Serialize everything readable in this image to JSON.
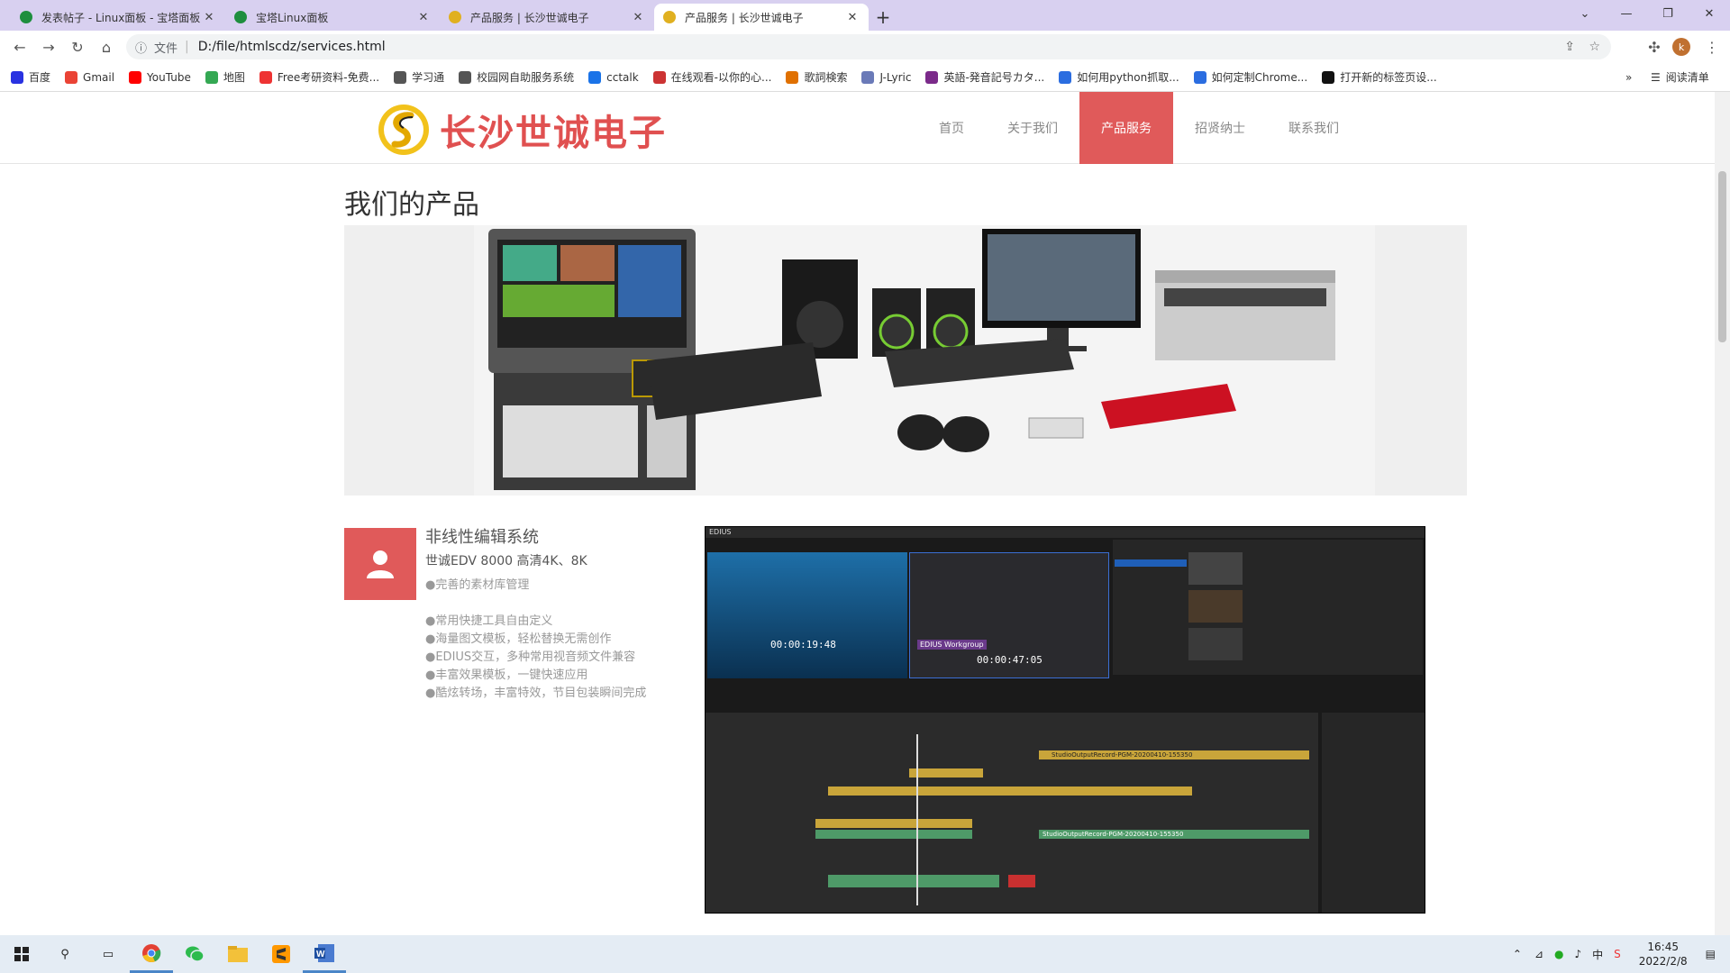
{
  "browser": {
    "tabs": [
      {
        "title": "发表帖子 - Linux面板 - 宝塔面板",
        "active": false
      },
      {
        "title": "宝塔Linux面板",
        "active": false
      },
      {
        "title": "产品服务 | 长沙世诚电子",
        "active": false
      },
      {
        "title": "产品服务 | 长沙世诚电子",
        "active": true
      }
    ],
    "new_tab": "+",
    "address": {
      "security_label": "文件",
      "url": "D:/file/htmlscdz/services.html"
    },
    "bookmarks": [
      {
        "label": "百度",
        "color": "#2932e1"
      },
      {
        "label": "Gmail",
        "color": "#ea4335"
      },
      {
        "label": "YouTube",
        "color": "#ff0000"
      },
      {
        "label": "地图",
        "color": "#34a853"
      },
      {
        "label": "Free考研资料-免费...",
        "color": "#e33"
      },
      {
        "label": "学习通",
        "color": "#555"
      },
      {
        "label": "校园网自助服务系统",
        "color": "#555"
      },
      {
        "label": "cctalk",
        "color": "#1a73e8"
      },
      {
        "label": "在线观看-以你的心...",
        "color": "#c33"
      },
      {
        "label": "歌詞検索",
        "color": "#e07000"
      },
      {
        "label": "J-Lyric",
        "color": "#6a7ab8"
      },
      {
        "label": "英語-発音記号カタ...",
        "color": "#7b2a8a"
      },
      {
        "label": "如何用python抓取...",
        "color": "#2b6de0"
      },
      {
        "label": "如何定制Chrome...",
        "color": "#2b6de0"
      },
      {
        "label": "打开新的标签页设...",
        "color": "#111"
      }
    ],
    "more": "»",
    "reading_list": "阅读清单"
  },
  "site": {
    "logo_text": "长沙世诚电子",
    "nav": [
      {
        "label": "首页",
        "active": false
      },
      {
        "label": "关于我们",
        "active": false
      },
      {
        "label": "产品服务",
        "active": true
      },
      {
        "label": "招贤纳士",
        "active": false
      },
      {
        "label": "联系我们",
        "active": false
      }
    ],
    "page_title": "我们的产品",
    "product": {
      "title": "非线性编辑系统",
      "subtitle": "世诚EDV 8000 高清4K、8K",
      "features": [
        "●完善的素材库管理",
        "●常用快捷工具自由定义",
        "●海量图文模板，轻松替换无需创作",
        "●EDIUS交互，多种常用视音频文件兼容",
        "●丰富效果模板，一键快速应用",
        "●酷炫转场，丰富特效，节目包装瞬间完成"
      ]
    },
    "screenshot_labels": {
      "app": "EDIUS",
      "tc1": "00:00:19:48",
      "tc2": "00:00:47:05",
      "workgroup": "EDIUS Workgroup",
      "clip": "StudioOutputRecord-PGM-20200410-155350",
      "clip2": "StudioOutputRecord-PGM-20200410-155350"
    },
    "accent": "#e05a5a"
  },
  "taskbar": {
    "time": "16:45",
    "date": "2022/2/8"
  }
}
